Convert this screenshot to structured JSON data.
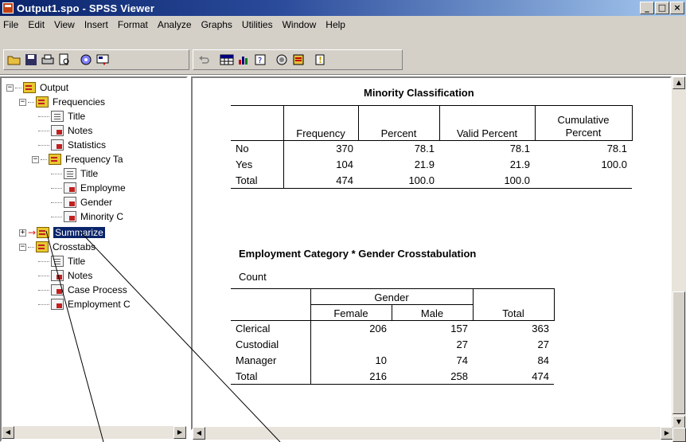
{
  "window": {
    "title": "Output1.spo - SPSS Viewer",
    "controls": [
      "minimize-icon",
      "maximize-icon",
      "close-icon"
    ]
  },
  "menu": [
    "File",
    "Edit",
    "View",
    "Insert",
    "Format",
    "Analyze",
    "Graphs",
    "Utilities",
    "Window",
    "Help"
  ],
  "toolbar": {
    "buttons": [
      "open-icon",
      "save-icon",
      "print-icon",
      "print-preview-icon",
      "export-icon",
      "dialog-recall-icon",
      "undo-icon",
      "goto-data-icon",
      "goto-chart-icon",
      "variables-icon",
      "select-cases-icon",
      "show-hide-icon",
      "pivot-icon"
    ]
  },
  "outline": {
    "items": [
      {
        "label": "Output",
        "icon": "book"
      },
      {
        "label": "Frequencies",
        "icon": "book"
      },
      {
        "label": "Title",
        "icon": "doc"
      },
      {
        "label": "Notes",
        "icon": "table"
      },
      {
        "label": "Statistics",
        "icon": "table"
      },
      {
        "label": "Frequency Ta",
        "icon": "book"
      },
      {
        "label": "Title",
        "icon": "doc"
      },
      {
        "label": "Employme",
        "icon": "table"
      },
      {
        "label": "Gender",
        "icon": "table"
      },
      {
        "label": "Minority C",
        "icon": "table"
      },
      {
        "label": "Summarize",
        "icon": "book"
      },
      {
        "label": "Crosstabs",
        "icon": "book"
      },
      {
        "label": "Title",
        "icon": "doc"
      },
      {
        "label": "Notes",
        "icon": "table"
      },
      {
        "label": "Case Process",
        "icon": "table"
      },
      {
        "label": "Employment C",
        "icon": "table"
      }
    ]
  },
  "minority_table": {
    "title": "Minority Classification",
    "headers": [
      "Frequency",
      "Percent",
      "Valid Percent",
      "Cumulative Percent"
    ],
    "rows": [
      {
        "label": "No",
        "values": [
          "370",
          "78.1",
          "78.1",
          "78.1"
        ]
      },
      {
        "label": "Yes",
        "values": [
          "104",
          "21.9",
          "21.9",
          "100.0"
        ]
      },
      {
        "label": "Total",
        "values": [
          "474",
          "100.0",
          "100.0",
          ""
        ]
      }
    ]
  },
  "crosstab": {
    "title": "Employment Category * Gender Crosstabulation",
    "subtitle": "Count",
    "group_header": "Gender",
    "col_headers": [
      "Female",
      "Male",
      "Total"
    ],
    "rows": [
      {
        "label": "Clerical",
        "values": [
          "206",
          "157",
          "363"
        ]
      },
      {
        "label": "Custodial",
        "values": [
          "",
          "27",
          "27"
        ]
      },
      {
        "label": "Manager",
        "values": [
          "10",
          "74",
          "84"
        ]
      },
      {
        "label": "Total",
        "values": [
          "216",
          "258",
          "474"
        ]
      }
    ]
  },
  "colors": {
    "titlebar": "#0a246a",
    "chrome": "#d4d0c8",
    "selection": "#0a246a",
    "callout_arrow": "#e02020"
  }
}
